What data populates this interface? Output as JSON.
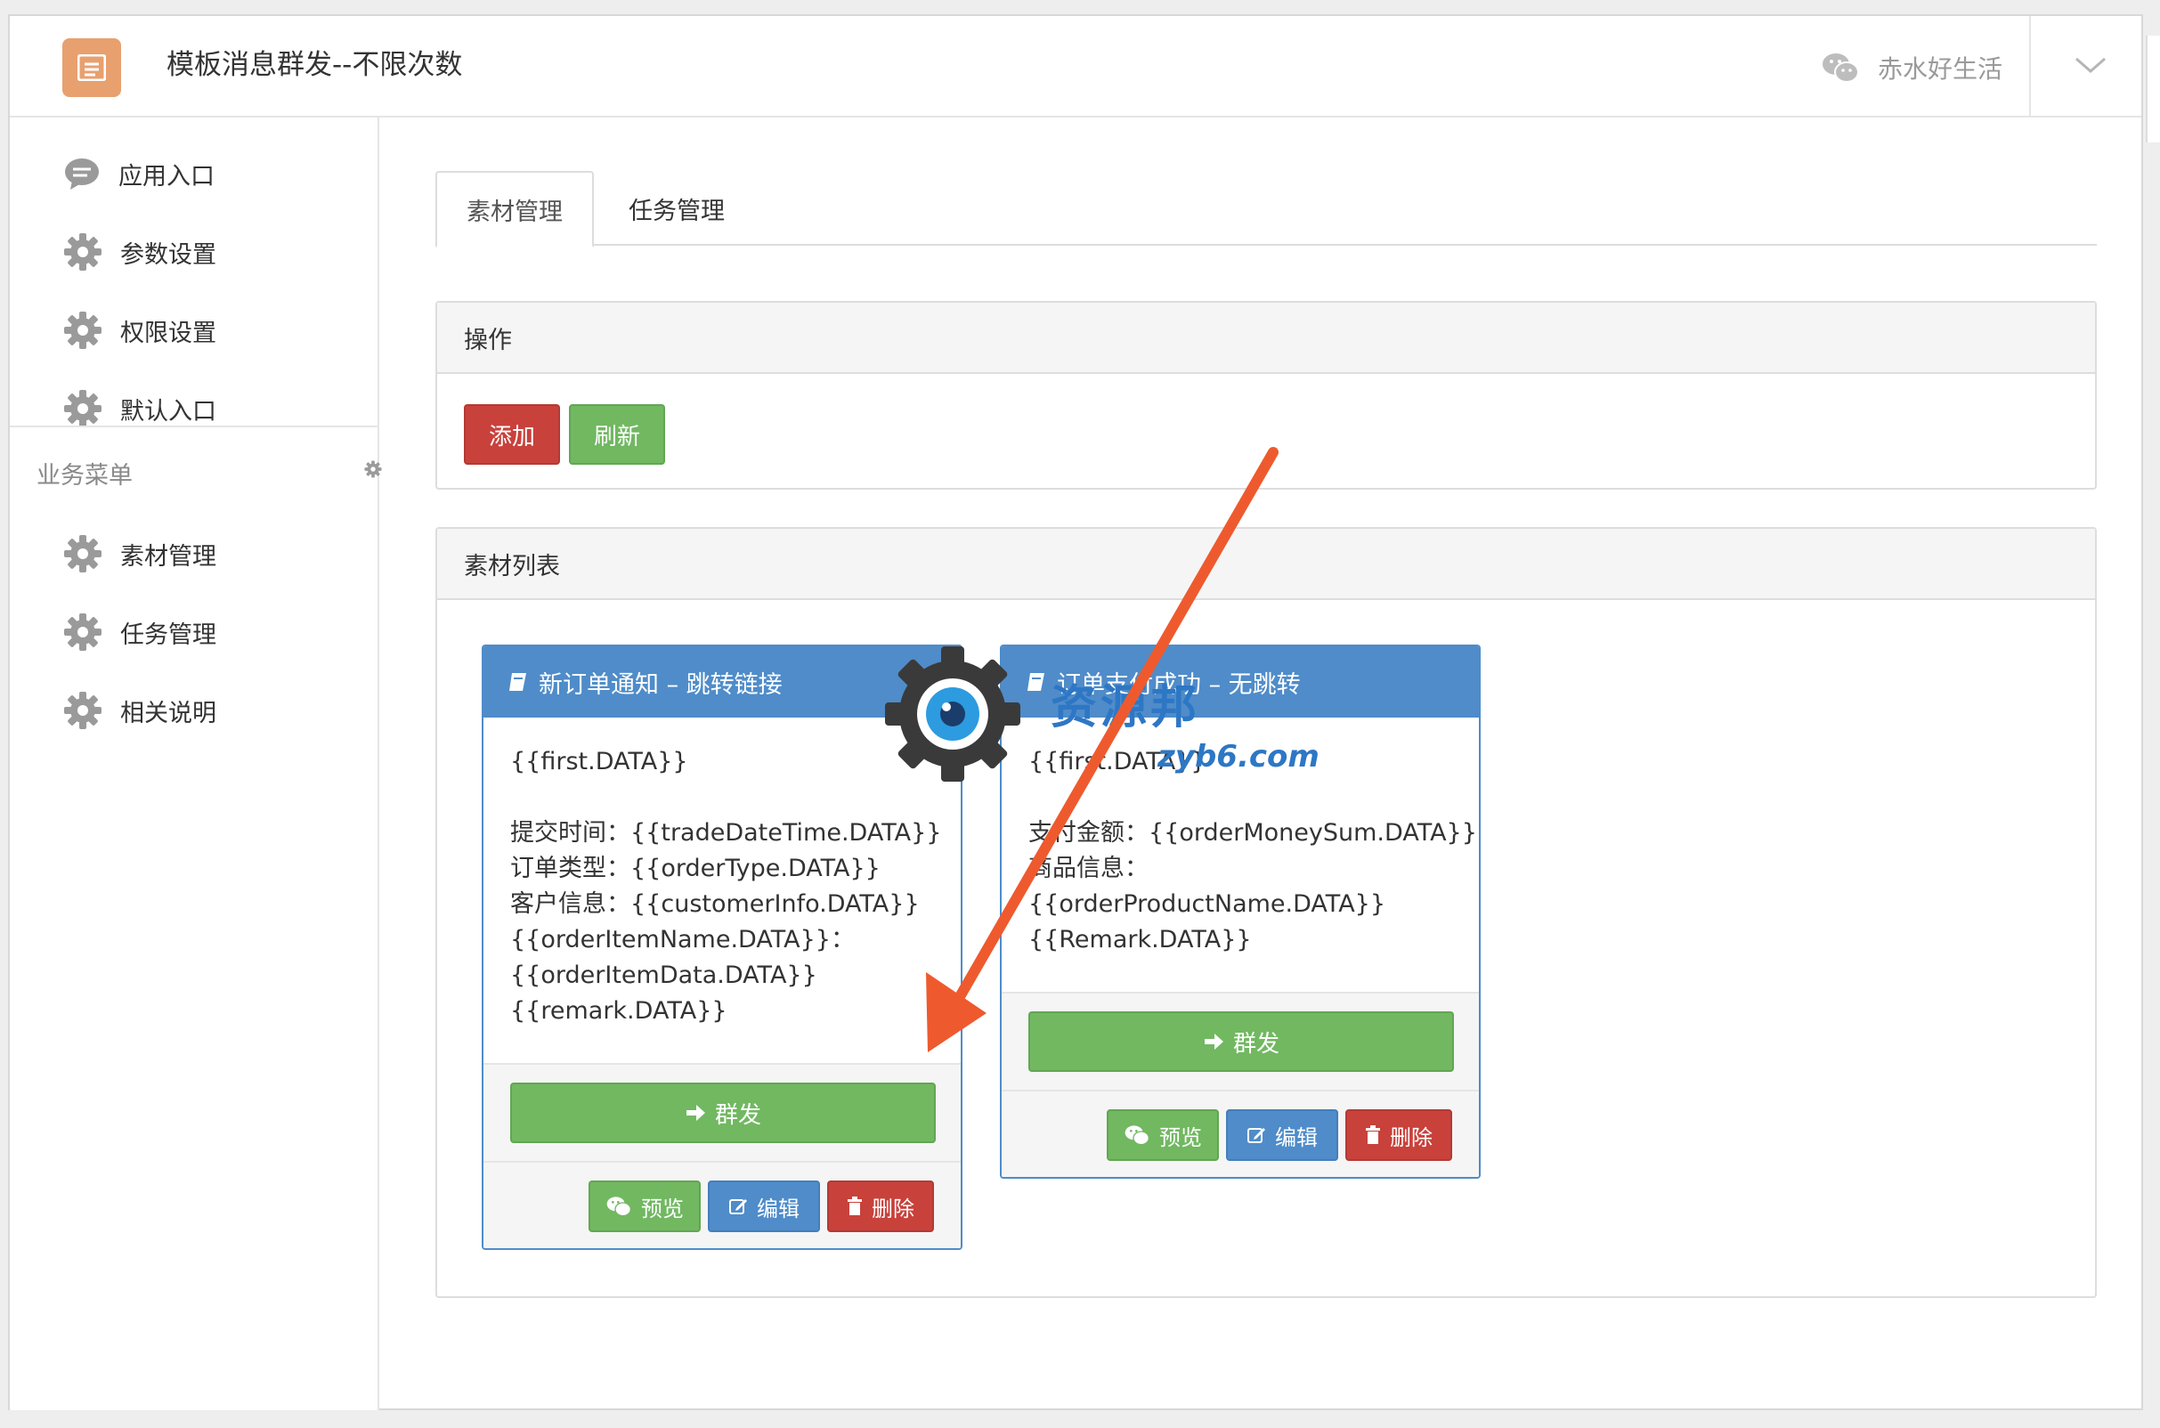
{
  "header": {
    "title": "模板消息群发--不限次数",
    "account_name": "赤水好生活"
  },
  "sidebar": {
    "items": [
      {
        "label": "应用入口",
        "icon": "chat-bubble-icon"
      },
      {
        "label": "参数设置",
        "icon": "gear-icon"
      },
      {
        "label": "权限设置",
        "icon": "gear-icon"
      },
      {
        "label": "默认入口",
        "icon": "gear-icon"
      }
    ],
    "group_title": "业务菜单",
    "group_items": [
      {
        "label": "素材管理",
        "icon": "gear-icon"
      },
      {
        "label": "任务管理",
        "icon": "gear-icon"
      },
      {
        "label": "相关说明",
        "icon": "gear-icon"
      }
    ]
  },
  "tabs": [
    {
      "label": "素材管理",
      "active": true
    },
    {
      "label": "任务管理",
      "active": false
    }
  ],
  "ops_panel": {
    "title": "操作",
    "add_label": "添加",
    "refresh_label": "刷新"
  },
  "list_panel": {
    "title": "素材列表"
  },
  "cards": [
    {
      "title": "新订单通知 – 跳转链接",
      "lines": [
        "{{first.DATA}}",
        "",
        "提交时间：{{tradeDateTime.DATA}}",
        "订单类型：{{orderType.DATA}}",
        "客户信息：{{customerInfo.DATA}}",
        "{{orderItemName.DATA}}：",
        "{{orderItemData.DATA}}",
        "{{remark.DATA}}"
      ],
      "send_label": "群发",
      "preview_label": "预览",
      "edit_label": "编辑",
      "delete_label": "删除"
    },
    {
      "title": "订单支付成功 – 无跳转",
      "lines": [
        "{{first.DATA}}",
        "",
        "支付金额：{{orderMoneySum.DATA}}",
        "商品信息：",
        "{{orderProductName.DATA}}",
        "{{Remark.DATA}}"
      ],
      "send_label": "群发",
      "preview_label": "预览",
      "edit_label": "编辑",
      "delete_label": "删除"
    }
  ],
  "watermark": {
    "text": "资源邦",
    "sub": "zyb6.com"
  },
  "colors": {
    "accent_blue": "#4f8cc9",
    "green": "#71b861",
    "red": "#c9413b",
    "logo_orange": "#e8a06f",
    "annotation_arrow": "#ee5a2e"
  }
}
